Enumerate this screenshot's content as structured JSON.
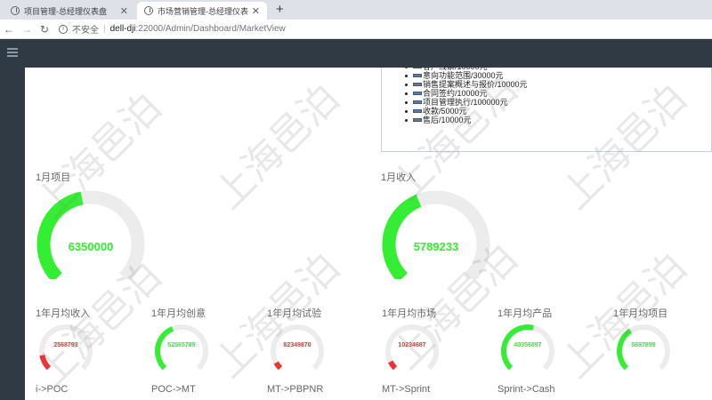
{
  "browser": {
    "tabs": [
      {
        "label": "项目管理-总经理仪表盘",
        "active": false
      },
      {
        "label": "市场营销管理-总经理仪表盘",
        "active": true
      }
    ],
    "new_tab": "+",
    "address": {
      "security_label": "不安全",
      "host": "dell-dji",
      "path": ":22000/Admin/Dashboard/MarketView"
    }
  },
  "legend": {
    "items": [
      {
        "label": "客户线索/10000元",
        "color": "#4a7fc1"
      },
      {
        "label": "意向功能范围/30000元",
        "color": "#4a7fc1"
      },
      {
        "label": "销售提案概述与报价/10000元",
        "color": "#4a7fc1"
      },
      {
        "label": "合同签约/10000元",
        "color": "#4a7fc1"
      },
      {
        "label": "项目管理执行/100000元",
        "color": "#4a7fc1"
      },
      {
        "label": "收款/5000元",
        "color": "#4a7fc1"
      },
      {
        "label": "售后/10000元",
        "color": "#4a7fc1"
      }
    ]
  },
  "big_gauges": [
    {
      "title": "1月项目",
      "value": "6350000",
      "fraction": 0.46,
      "color": "#33ee33"
    },
    {
      "title": "1月收入",
      "value": "5789233",
      "fraction": 0.42,
      "color": "#33ee33"
    }
  ],
  "small_gauges": [
    {
      "title": "1年月均收入",
      "value": "2568793",
      "fraction": 0.13,
      "color": "#ee3333",
      "flow": "i->POC"
    },
    {
      "title": "1年月均创意",
      "value": "52565789",
      "fraction": 0.42,
      "color": "#33ee33",
      "flow": "POC->MT"
    },
    {
      "title": "1年月均试验",
      "value": "82349870",
      "fraction": 0.06,
      "color": "#ee3333",
      "flow": "MT->PBPNR"
    },
    {
      "title": "1年月均市场",
      "value": "10234687",
      "fraction": 0.07,
      "color": "#ee3333",
      "flow": "MT->Sprint"
    },
    {
      "title": "1年月均产品",
      "value": "40356897",
      "fraction": 0.55,
      "color": "#33ee33",
      "flow": "Sprint->Cash"
    },
    {
      "title": "1年月均项目",
      "value": "5697899",
      "fraction": 0.38,
      "color": "#33ee33",
      "flow": ""
    }
  ],
  "watermark": "上海邑泊",
  "colors": {
    "header_bg": "#2f3a45",
    "gauge_track": "#ececec"
  }
}
